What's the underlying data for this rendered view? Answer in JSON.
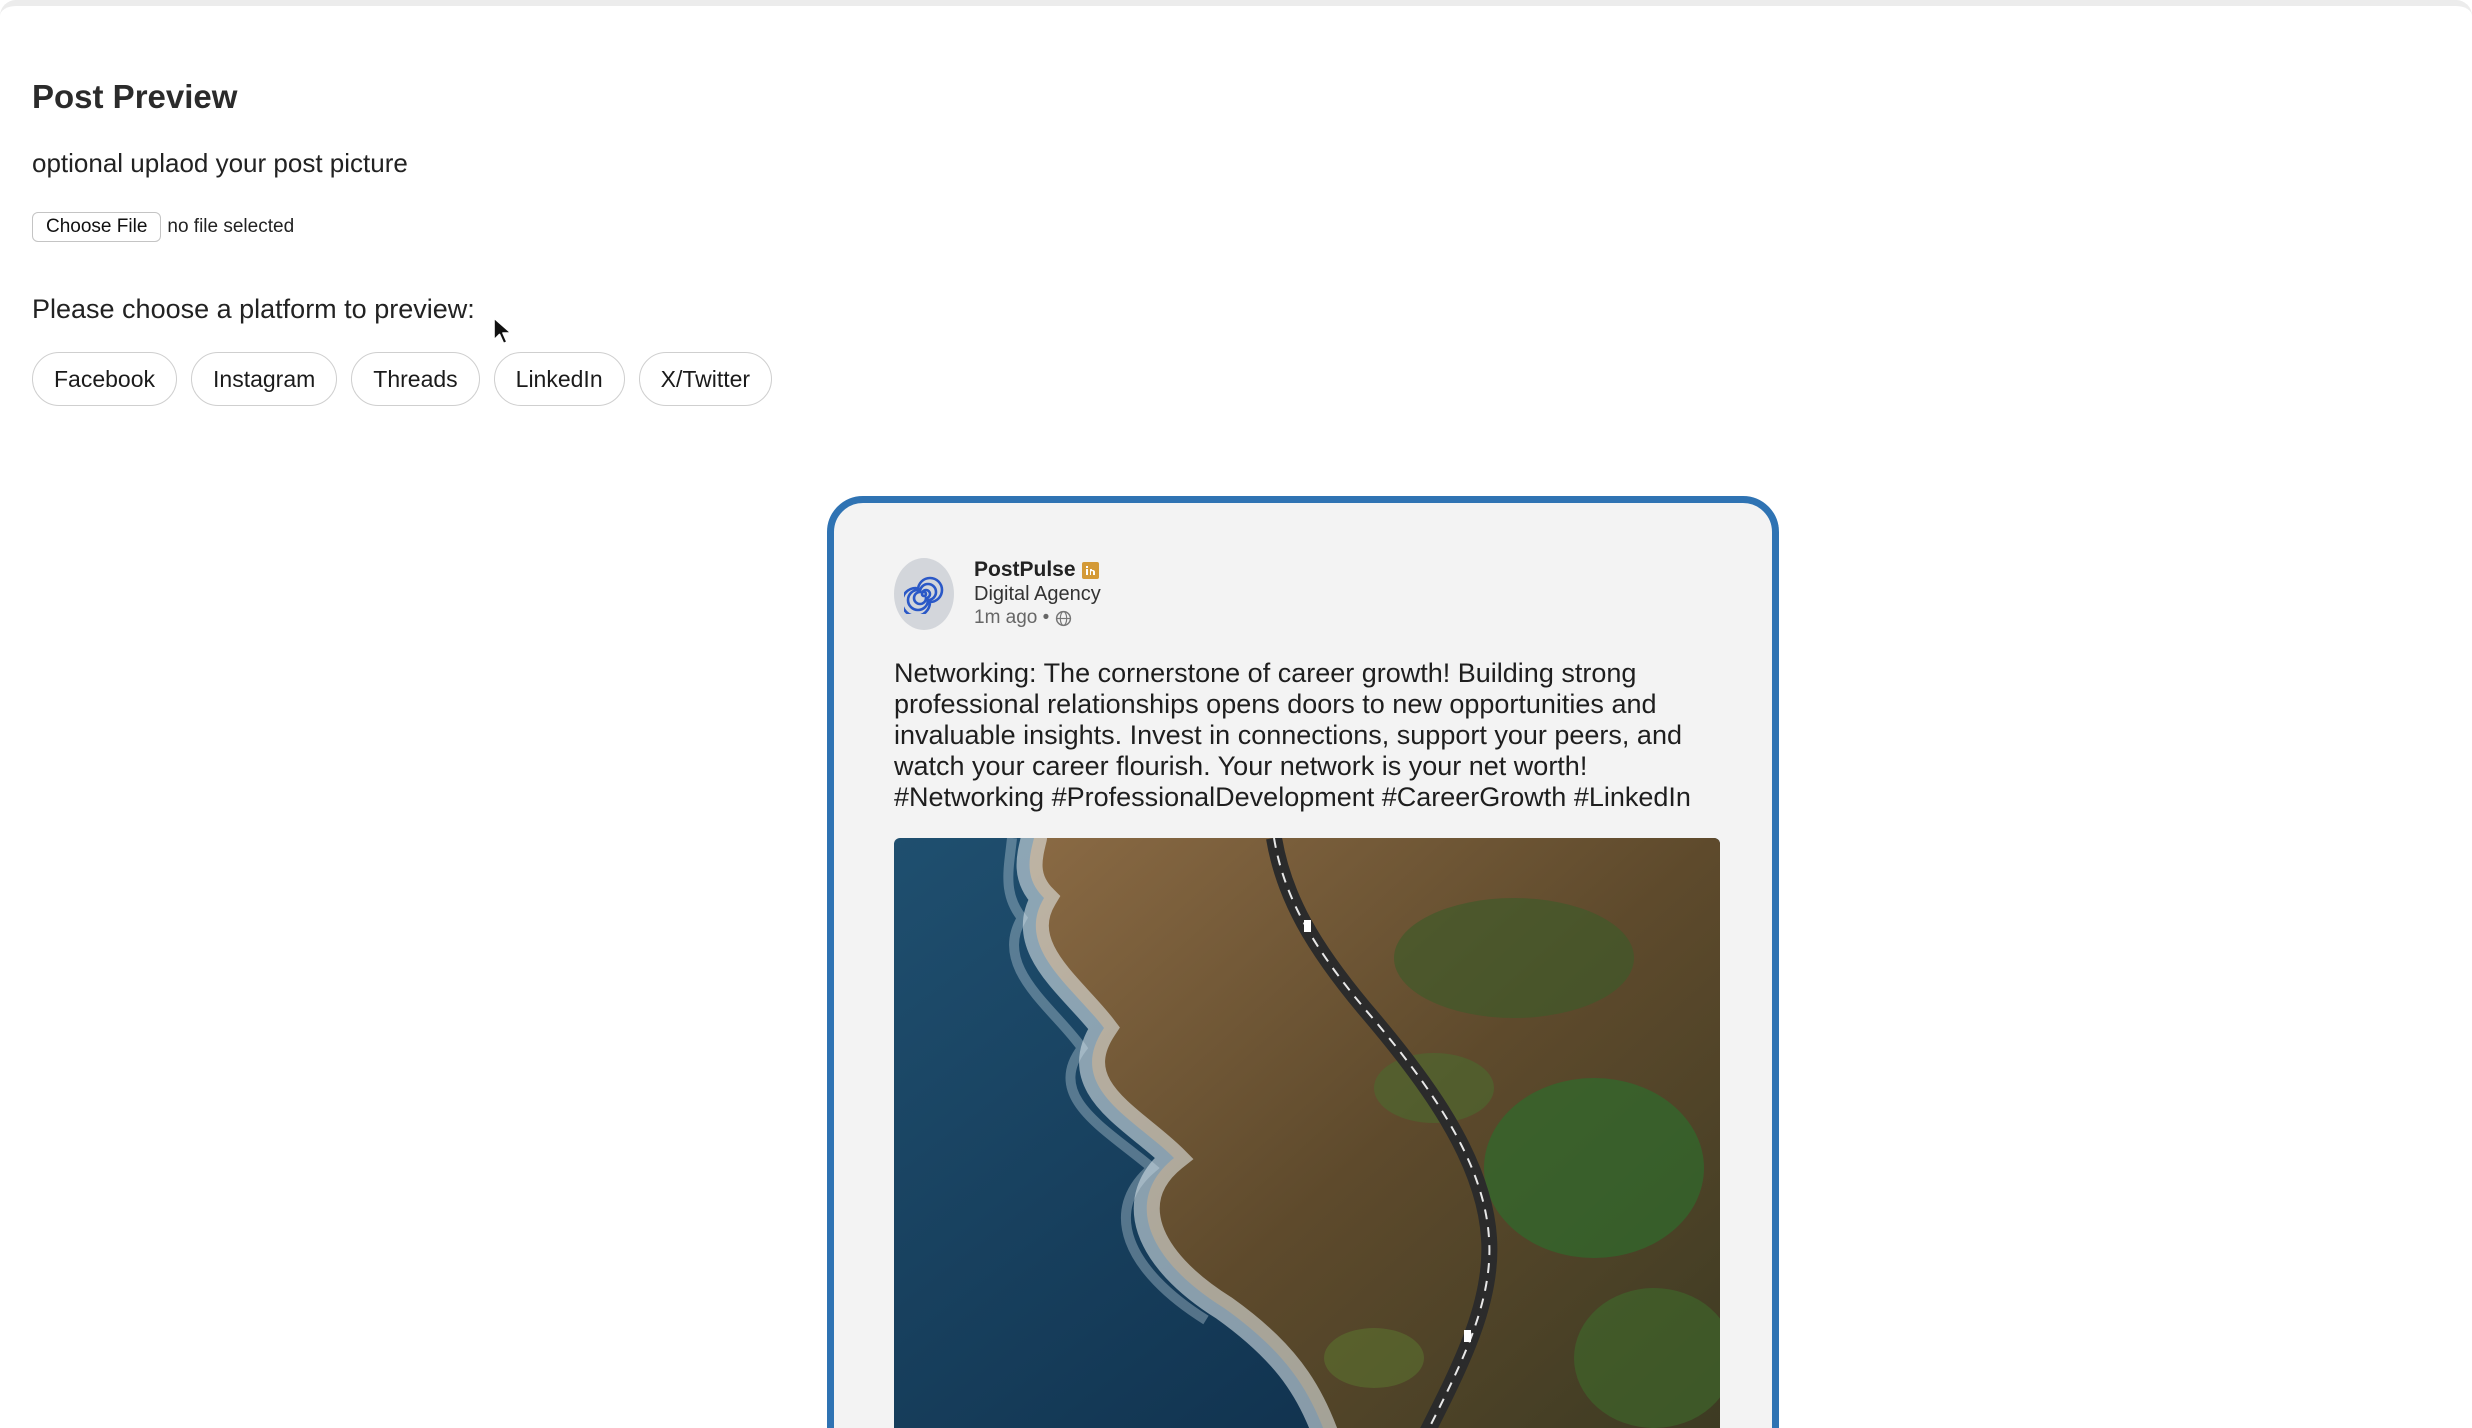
{
  "header": {
    "title": "Post Preview",
    "upload_label": "optional uplaod your post picture"
  },
  "file_input": {
    "button_label": "Choose File",
    "status": "no file selected"
  },
  "platform_prompt": "Please choose a platform to preview:",
  "platforms": [
    "Facebook",
    "Instagram",
    "Threads",
    "LinkedIn",
    "X/Twitter"
  ],
  "post": {
    "author": "PostPulse",
    "company": "Digital Agency",
    "time": "1m ago •",
    "text": "Networking: The cornerstone of career growth! Building strong professional relationships opens doors to new opportunities and invaluable insights. Invest in connections, support your peers, and watch your career flourish. Your network is your net worth! #Networking #ProfessionalDevelopment #CareerGrowth #LinkedIn",
    "image_icon": "aerial-coastal-road-photo"
  },
  "icons": {
    "avatar": "spiral-logo-icon",
    "badge": "linkedin-badge-icon",
    "visibility": "globe-icon",
    "cursor": "mouse-cursor-icon"
  },
  "colors": {
    "frame_border": "#2f73b3",
    "frame_background": "#f3f3f3",
    "badge": "#d49a37"
  }
}
